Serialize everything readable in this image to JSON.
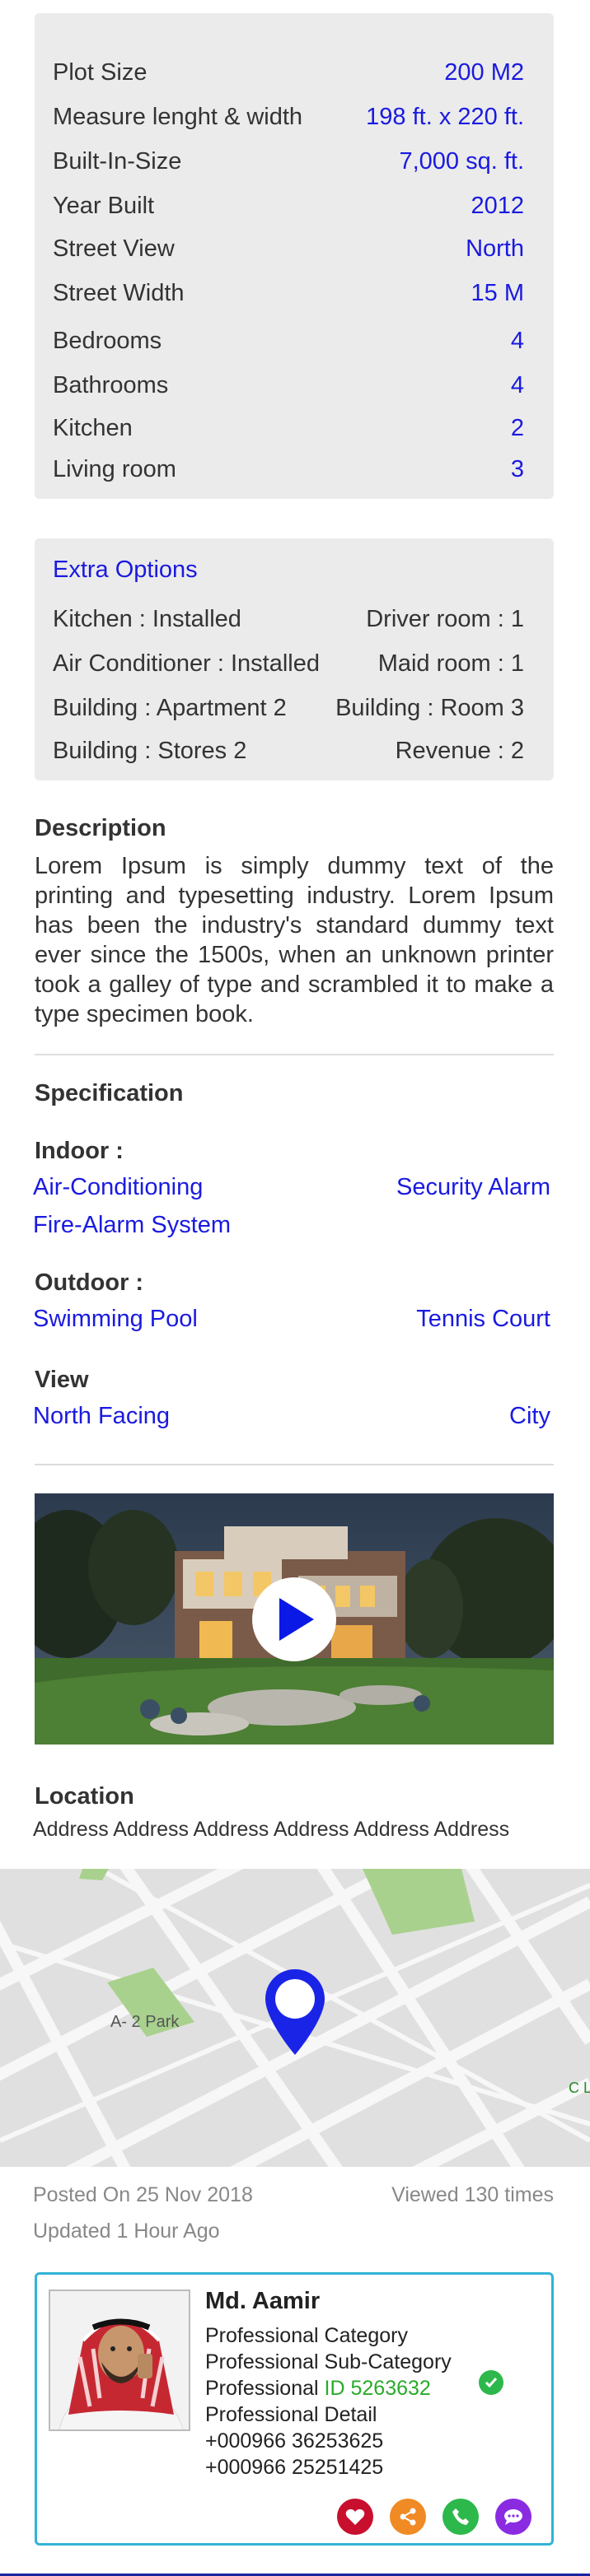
{
  "property_details": [
    {
      "label": "Plot Size",
      "value": "200 M2"
    },
    {
      "label": "Measure lenght & width",
      "value": "198 ft. x 220 ft."
    },
    {
      "label": "Built-In-Size",
      "value": "7,000 sq. ft."
    },
    {
      "label": "Year Built",
      "value": "2012"
    },
    {
      "label": "Street View",
      "value": "North"
    },
    {
      "label": "Street Width",
      "value": "15 M"
    },
    {
      "label": "Bedrooms",
      "value": "4"
    },
    {
      "label": "Bathrooms",
      "value": "4"
    },
    {
      "label": "Kitchen",
      "value": "2"
    },
    {
      "label": "Living room",
      "value": "3"
    }
  ],
  "extra_options": {
    "title": "Extra Options",
    "rows": [
      {
        "left": "Kitchen : Installed",
        "right": "Driver room : 1"
      },
      {
        "left": "Air Conditioner : Installed",
        "right": "Maid room : 1"
      },
      {
        "left": "Building : Apartment 2",
        "right": "Building : Room 3"
      },
      {
        "left": "Building : Stores 2",
        "right": "Revenue : 2"
      }
    ]
  },
  "description": {
    "title": "Description",
    "text": "Lorem Ipsum is simply dummy text of the printing and typesetting industry. Lorem Ipsum has been the industry's standard dummy text ever since the 1500s, when an unknown printer took a galley of type and scrambled it to make a type specimen book."
  },
  "specification": {
    "title": "Specification",
    "indoor": {
      "label": "Indoor :",
      "items": [
        "Air-Conditioning",
        "Security Alarm",
        "Fire-Alarm System"
      ]
    },
    "outdoor": {
      "label": "Outdoor :",
      "items": [
        "Swimming Pool",
        "Tennis Court"
      ]
    },
    "view": {
      "label": "View",
      "items": [
        "North Facing",
        "City"
      ]
    }
  },
  "location": {
    "title": "Location",
    "address": "Address Address Address Address Address Address",
    "map_labels": {
      "park": "A- 2 Park",
      "edge": "C L"
    }
  },
  "meta": {
    "posted": "Posted On 25 Nov 2018",
    "viewed": "Viewed 130 times",
    "updated": "Updated 1 Hour Ago"
  },
  "agent": {
    "name": "Md. Aamir",
    "category": "Professional Category",
    "sub_category": "Professional Sub-Category",
    "id_prefix": "Professional",
    "id": "ID 5263632",
    "detail": "Professional Detail",
    "phone1": "+000966 36253625",
    "phone2": "+000966 25251425"
  },
  "icons": {
    "play": "play-icon",
    "map_pin": "map-pin-icon",
    "verified": "check-circle-icon",
    "favorite": "heart-icon",
    "share": "share-icon",
    "call": "phone-icon",
    "chat": "chat-icon"
  },
  "colors": {
    "accent_blue": "#1a1ae0",
    "card_border": "#33b3d6",
    "verified_green": "#2db84b",
    "heart_red": "#c8102e",
    "share_orange": "#f08a24",
    "call_green": "#2db84b",
    "chat_purple": "#8a2be2"
  }
}
